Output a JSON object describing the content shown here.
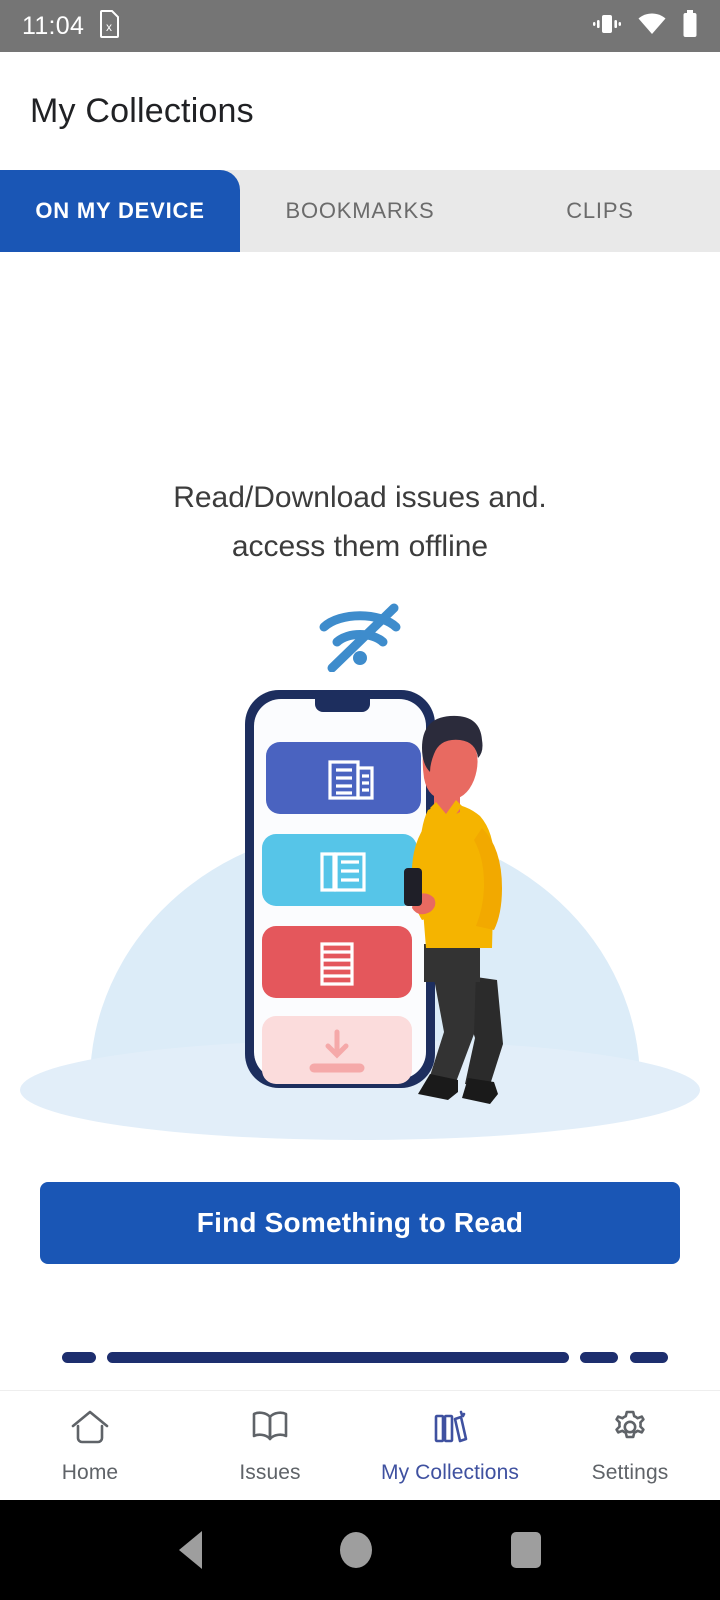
{
  "statusbar": {
    "time": "11:04",
    "icons": [
      "sim-card-error-icon",
      "vibrate-icon",
      "wifi-icon",
      "battery-icon"
    ]
  },
  "appbar": {
    "title": "My Collections"
  },
  "tabs": [
    {
      "label": "ON MY DEVICE",
      "active": true
    },
    {
      "label": "BOOKMARKS",
      "active": false
    },
    {
      "label": "CLIPS",
      "active": false
    }
  ],
  "empty_state": {
    "line1": "Read/Download issues and.",
    "line2": "access them offline",
    "icon": "wifi-off-icon",
    "illustration": "man-leaning-on-phone-with-content-cards"
  },
  "cta": {
    "label": "Find Something to Read"
  },
  "bottom_nav": [
    {
      "label": "Home",
      "icon": "home-icon",
      "active": false
    },
    {
      "label": "Issues",
      "icon": "open-book-icon",
      "active": false
    },
    {
      "label": "My Collections",
      "icon": "books-shelf-icon",
      "active": true
    },
    {
      "label": "Settings",
      "icon": "gear-icon",
      "active": false
    }
  ],
  "android_nav": [
    {
      "label": "Back",
      "icon": "triangle-back-icon"
    },
    {
      "label": "Home",
      "icon": "circle-home-icon"
    },
    {
      "label": "Recents",
      "icon": "square-recents-icon"
    }
  ],
  "colors": {
    "primary_blue": "#1a56b5",
    "tab_inactive_bg": "#e9e9e9",
    "tab_inactive_text": "#6b6b6b",
    "statusbar_bg": "#757575",
    "nav_active": "#3f51a0",
    "nav_inactive": "#5f6368",
    "illus_backdrop": "#dcecf8",
    "illus_navy": "#1d2e5e",
    "card_blue": "#4a63c0",
    "card_cyan": "#56c5e8",
    "card_red": "#e4575c",
    "card_pink": "#fbdcdc",
    "shirt_yellow": "#f5b400",
    "skin": "#e86a61"
  }
}
